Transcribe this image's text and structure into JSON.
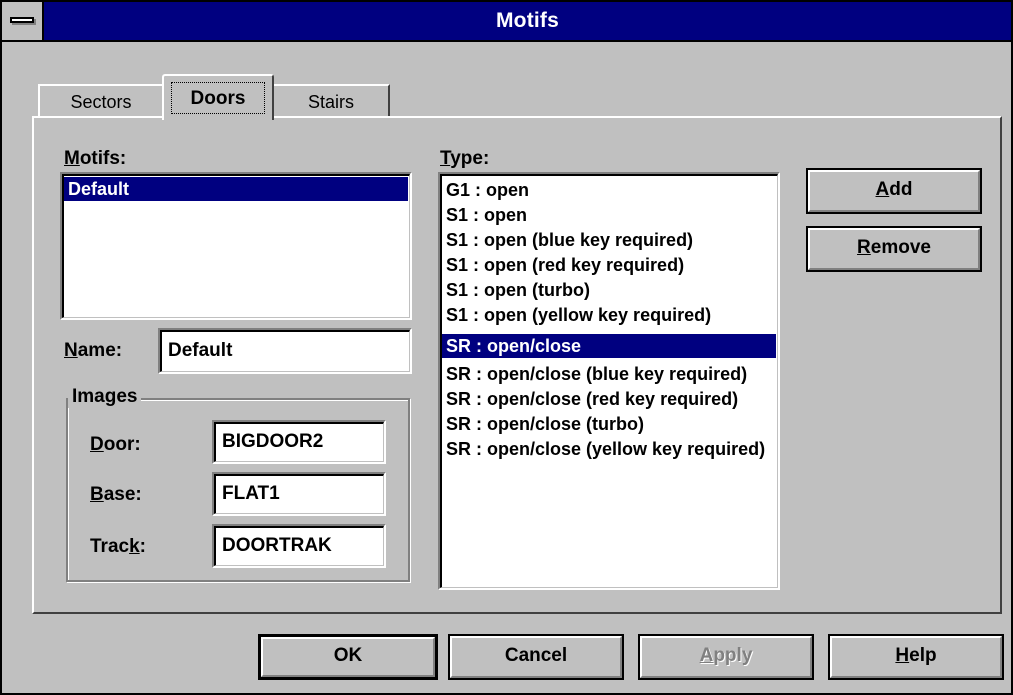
{
  "window": {
    "title": "Motifs"
  },
  "tabs": [
    {
      "label": "Sectors",
      "active": false
    },
    {
      "label": "Doors",
      "active": true
    },
    {
      "label": "Stairs",
      "active": false
    }
  ],
  "motifs": {
    "label_first": "M",
    "label_rest": "otifs:",
    "items": [
      "Default"
    ],
    "selected_index": 0
  },
  "name_field": {
    "label_first": "N",
    "label_rest": "ame:",
    "value": "Default"
  },
  "images": {
    "group_title": "Images",
    "door": {
      "label_first": "D",
      "label_rest": "oor:",
      "value": "BIGDOOR2"
    },
    "base": {
      "label_first": "B",
      "label_rest": "ase:",
      "value": "FLAT1"
    },
    "track": {
      "label_pre": "Trac",
      "label_key": "k",
      "label_post": ":",
      "value": "DOORTRAK"
    }
  },
  "type": {
    "label_first": "T",
    "label_rest": "ype:",
    "items": [
      "G1 : open",
      "S1 : open",
      "S1 : open (blue key required)",
      "S1 : open (red key required)",
      "S1 : open (turbo)",
      "S1 : open (yellow key required)",
      "SR : open/close",
      "SR : open/close (blue key required)",
      "SR : open/close (red key required)",
      "SR : open/close (turbo)",
      "SR : open/close (yellow key required)"
    ],
    "selected_index": 6
  },
  "buttons": {
    "add": {
      "first": "A",
      "rest": "dd"
    },
    "remove": {
      "first": "R",
      "rest": "emove"
    },
    "ok": {
      "label": "OK"
    },
    "cancel": {
      "label": "Cancel"
    },
    "apply": {
      "first": "A",
      "rest": "pply",
      "disabled": true
    },
    "help": {
      "first": "H",
      "rest": "elp"
    }
  },
  "colors": {
    "titlebar": "#000080",
    "face": "#c0c0c0",
    "selection": "#000080"
  }
}
